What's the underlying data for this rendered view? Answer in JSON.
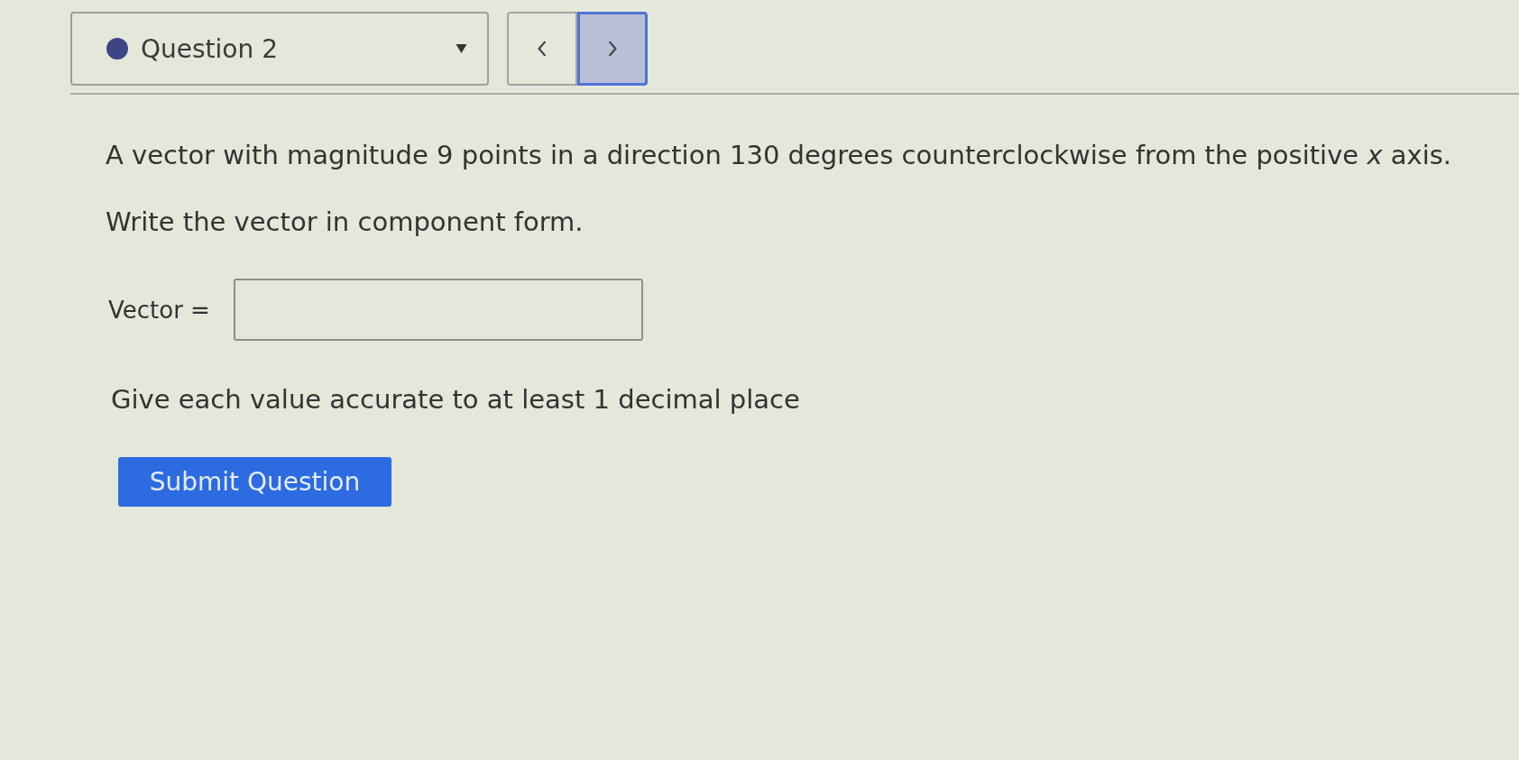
{
  "question_selector": {
    "label": "Question 2"
  },
  "nav_buttons": [
    {
      "kind": "previous",
      "highlighted": false
    },
    {
      "kind": "next",
      "highlighted": true
    }
  ],
  "question": {
    "text": "A vector with magnitude 9 points in a direction 130 degrees counterclockwise from the positive *x* axis.",
    "instruction": "Write the vector in component form."
  },
  "answer": {
    "label": "Vector ="
  },
  "hint": "Give each value accurate to at least 1 decimal place",
  "submit_button": "Submit Question"
}
